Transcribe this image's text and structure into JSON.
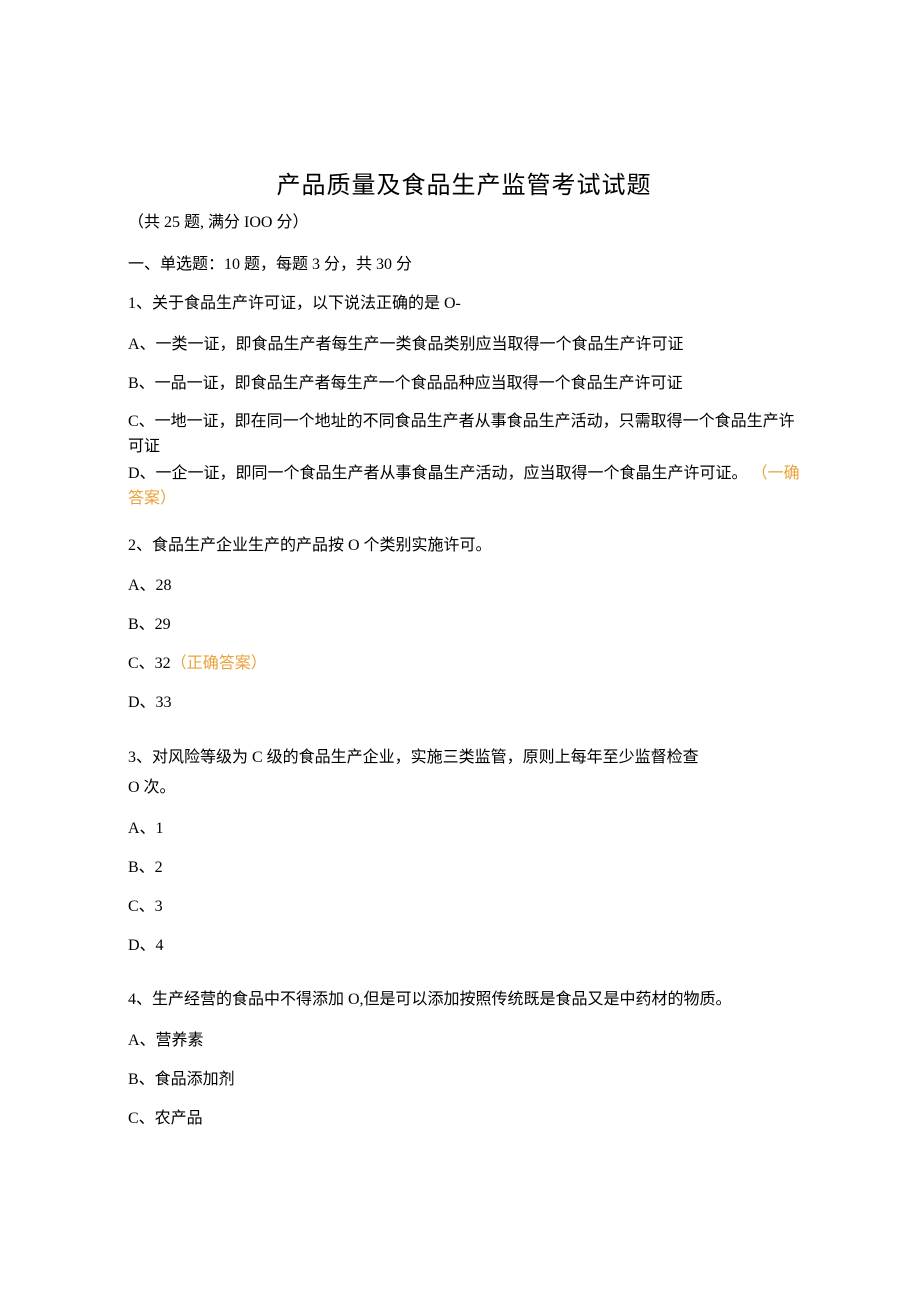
{
  "title": "产品质量及食品生产监管考试试题",
  "subtitle": "（共 25 题, 满分 IOO 分）",
  "section1_header": "一、单选题：10 题，每题 3 分，共 30 分",
  "q1": {
    "text": "1、关于食品生产许可证，以下说法正确的是 O-",
    "a": "A、一类一证，即食品生产者每生产一类食品类别应当取得一个食品生产许可证",
    "b": "B、一品一证，即食品生产者每生产一个食品品种应当取得一个食品生产许可证",
    "c": "C、一地一证，即在同一个地址的不同食品生产者从事食品生产活动，只需取得一个食品生产许可证",
    "d_pre": "D、一企一证，即同一个食品生产者从事食晶生产活动，应当取得一个食晶生产许可证。 ",
    "d_ans": "（一确答案）"
  },
  "q2": {
    "text": "2、食品生产企业生产的产品按 O 个类别实施许可。",
    "a": "A、28",
    "b": "B、29",
    "c_pre": "C、32",
    "c_ans": "（正确答案）",
    "d": "D、33"
  },
  "q3": {
    "text1": "3、对风险等级为 C 级的食品生产企业，实施三类监管，原则上每年至少监督检查",
    "text2": "O 次。",
    "a": "A、1",
    "b": "B、2",
    "c": "C、3",
    "d": "D、4"
  },
  "q4": {
    "text": "4、生产经营的食品中不得添加 O,但是可以添加按照传统既是食品又是中药材的物质。",
    "a": "A、营养素",
    "b": "B、食品添加剂",
    "c": "C、农产品"
  }
}
